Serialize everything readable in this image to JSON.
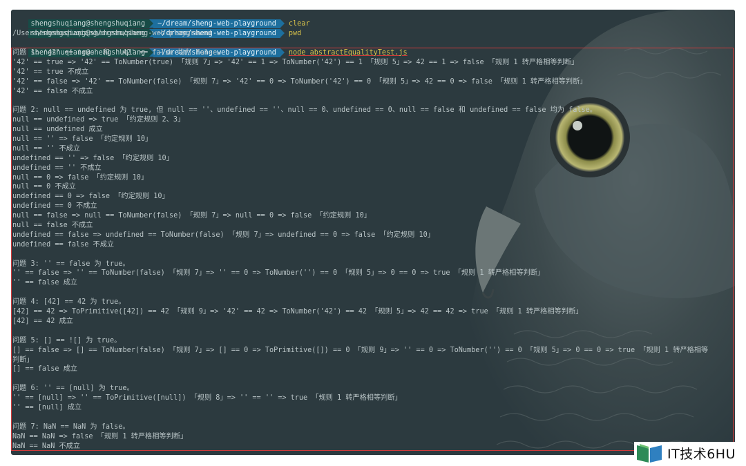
{
  "terminal": {
    "prompt_user": "shengshuqiang@shengshuqiang",
    "prompt_path": "~/dream/sheng-web-playground",
    "commands": [
      "clear",
      "pwd"
    ],
    "pwd_output": "/Users/shengshuqiang/dream/sheng-web-playground",
    "last_command": "node abstractEqualityTest.js",
    "output_lines": [
      "问题 1: '42' == true  和  '42' == false 均为 false。",
      "'42' == true => '42' == ToNumber(true) 「规则 7」=> '42' == 1 => ToNumber('42') == 1 「规则 5」=> 42 == 1 => false 「规则 1 转严格相等判断」",
      "'42' == true 不成立",
      "'42' == false => '42' == ToNumber(false) 「规则 7」=> '42' == 0 => ToNumber('42') == 0 「规则 5」=> 42 == 0 => false 「规则 1 转严格相等判断」",
      "'42' == false 不成立",
      "",
      "问题 2: null == undefined 为 true, 但 null == ''、undefined == ''、null == 0、undefined == 0、null == false 和 undefined == false 均为 false。",
      "null == undefined => true 「约定规则 2、3」",
      "null == undefined 成立",
      "null == '' => false 「约定规则 10」",
      "null == '' 不成立",
      "undefined == '' => false 「约定规则 10」",
      "undefined == '' 不成立",
      "null == 0 => false 「约定规则 10」",
      "null == 0 不成立",
      "undefined == 0 => false 「约定规则 10」",
      "undefined == 0 不成立",
      "null == false => null == ToNumber(false) 「规则 7」=> null == 0 => false 「约定规则 10」",
      "null == false 不成立",
      "undefined == false => undefined == ToNumber(false) 「规则 7」=> undefined == 0 => false 「约定规则 10」",
      "undefined == false 不成立",
      "",
      "问题 3: '' == false 为 true。",
      "'' == false => '' == ToNumber(false) 「规则 7」=> '' == 0 => ToNumber('') == 0 「规则 5」=> 0 == 0 => true 「规则 1 转严格相等判断」",
      "'' == false 成立",
      "",
      "问题 4: [42] == 42 为 true。",
      "[42] == 42 => ToPrimitive([42]) == 42 「规则 9」=> '42' == 42 => ToNumber('42') == 42 「规则 5」=> 42 == 42 => true 「规则 1 转严格相等判断」",
      "[42] == 42 成立",
      "",
      "问题 5: [] == ![] 为 true。",
      "[] == false => [] == ToNumber(false) 「规则 7」=> [] == 0 => ToPrimitive([]) == 0 「规则 9」=> '' == 0 => ToNumber('') == 0 「规则 5」=> 0 == 0 => true 「规则 1 转严格相等",
      "判断」",
      "[] == false 成立",
      "",
      "问题 6: '' == [null] 为 true。",
      "'' == [null] => '' == ToPrimitive([null]) 「规则 8」=> '' == '' => true 「规则 1 转严格相等判断」",
      "'' == [null] 成立",
      "",
      "问题 7: NaN == NaN 为 false。",
      "NaN == NaN => false 「规则 1 转严格相等判断」",
      "NaN == NaN 不成立"
    ]
  },
  "watermark": {
    "text": "IT技术6HU",
    "icon": "book-icon"
  },
  "colors": {
    "terminal_bg": "#2c3a3f",
    "user_segment": "#174b46",
    "path_segment": "#1d6f9e",
    "command": "#d8c24a",
    "output_text": "#b9c4c6",
    "highlight_border": "#d23a3a"
  }
}
